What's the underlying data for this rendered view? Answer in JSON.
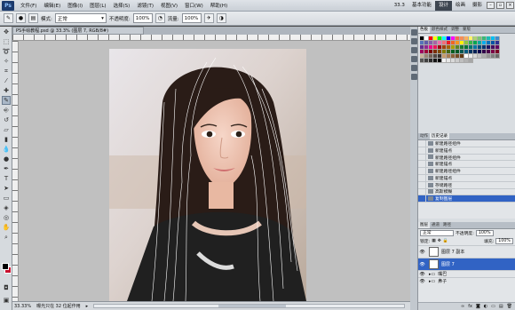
{
  "menubar": {
    "logo": "Ps",
    "items": [
      "文件(F)",
      "编辑(E)",
      "图像(I)",
      "图层(L)",
      "选择(S)",
      "滤镜(T)",
      "视图(V)",
      "窗口(W)",
      "帮助(H)"
    ],
    "zoom": "33.3",
    "workspaces": [
      "基本功能",
      "设计",
      "绘画",
      "摄影"
    ],
    "active_workspace": "设计"
  },
  "options": {
    "mode_label": "模式:",
    "mode_value": "正常",
    "opacity_label": "不透明度:",
    "opacity_value": "100%",
    "flow_label": "流量:",
    "flow_value": "100%"
  },
  "document": {
    "tab_title": "PS手绘教程.psd @ 33.3% (图层 7, RGB/8#)",
    "zoom_status": "33.33%",
    "status_text": "曝光只在 32 位起作用"
  },
  "swatches": {
    "tabs": [
      "色板",
      "颜色样式",
      "调整",
      "蒙版"
    ],
    "active_tab": "色板",
    "colors": [
      "#000000",
      "#ffffff",
      "#ff0000",
      "#ffff00",
      "#00ff00",
      "#00ffff",
      "#0000ff",
      "#ff00ff",
      "#f26c4f",
      "#f68e56",
      "#fbaf5d",
      "#fff568",
      "#acd372",
      "#7cc576",
      "#3bb878",
      "#1abbb4",
      "#00bff3",
      "#438ccb",
      "#5574b9",
      "#605ca8",
      "#855fa8",
      "#a763a8",
      "#f06eaa",
      "#f26d7d",
      "#ed1c24",
      "#f26522",
      "#f7941d",
      "#fff200",
      "#8dc63f",
      "#39b54a",
      "#00a651",
      "#00a99d",
      "#00aeef",
      "#0072bc",
      "#0054a6",
      "#2e3192",
      "#662d91",
      "#92278f",
      "#ec008c",
      "#ed145b",
      "#9e0b0f",
      "#a0410d",
      "#a36209",
      "#aba000",
      "#598527",
      "#1a7b30",
      "#007236",
      "#00746b",
      "#0076a3",
      "#004b80",
      "#003471",
      "#1b1464",
      "#440e62",
      "#630460",
      "#9e005d",
      "#9e0039",
      "#790000",
      "#7b2e00",
      "#7d4900",
      "#827b00",
      "#406618",
      "#005e20",
      "#005826",
      "#005952",
      "#005b7f",
      "#003663",
      "#002157",
      "#0d004c",
      "#32004b",
      "#4b0049",
      "#7b0046",
      "#7a0026",
      "#c7b299",
      "#998675",
      "#736357",
      "#534741",
      "#37302d",
      "#c69c6d",
      "#a67c52",
      "#8c6239",
      "#754c24",
      "#603913",
      "#ffffff",
      "#ebebeb",
      "#d7d7d7",
      "#c2c2c2",
      "#acacac",
      "#959595",
      "#808080",
      "#6b6b6b",
      "#555555",
      "#404040",
      "#2b2b2b",
      "#151515",
      "#000000",
      "#f2f2f2",
      "#e6e6e6",
      "#d9d9d9",
      "#cccccc",
      "#bfbfbf",
      "#b3b3b3",
      "#a6a6a6"
    ]
  },
  "history": {
    "tabs": [
      "动作",
      "历史记录"
    ],
    "active_tab": "历史记录",
    "items": [
      {
        "label": "新建路径组件",
        "selected": false
      },
      {
        "label": "新建锚点",
        "selected": false
      },
      {
        "label": "新建路径组件",
        "selected": false
      },
      {
        "label": "新建锚点",
        "selected": false
      },
      {
        "label": "新建路径组件",
        "selected": false
      },
      {
        "label": "新建锚点",
        "selected": false
      },
      {
        "label": "存储路径",
        "selected": false
      },
      {
        "label": "高斯模糊",
        "selected": false
      },
      {
        "label": "复制图层",
        "selected": true
      }
    ]
  },
  "layers": {
    "tabs": [
      "图层",
      "通道",
      "路径"
    ],
    "active_tab": "图层",
    "blend_mode": "正常",
    "opacity_label": "不透明度:",
    "opacity_value": "100%",
    "lock_label": "锁定:",
    "fill_label": "填充:",
    "fill_value": "100%",
    "items": [
      {
        "label": "图层 7 副本",
        "selected": false,
        "type": "layer"
      },
      {
        "label": "图层 7",
        "selected": true,
        "type": "layer"
      },
      {
        "label": "嘴巴",
        "selected": false,
        "type": "group"
      },
      {
        "label": "鼻子",
        "selected": false,
        "type": "group"
      }
    ]
  }
}
